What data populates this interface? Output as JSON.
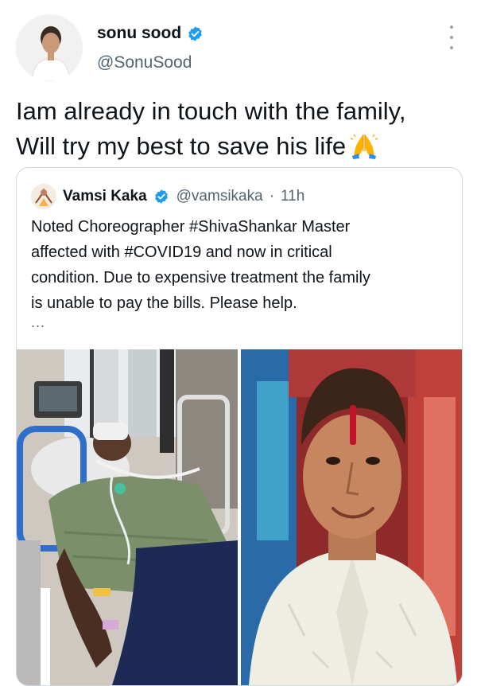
{
  "tweet": {
    "author": {
      "name": "sonu sood",
      "handle": "@SonuSood"
    },
    "text_lines": [
      "Iam already in touch with the family,",
      "Will try my best to save his life"
    ],
    "emoji": "folded-hands-icon"
  },
  "quoted_tweet": {
    "author": {
      "name": "Vamsi Kaka",
      "handle": "@vamsikaka",
      "separator": "·",
      "time": "11h"
    },
    "text_lines": [
      "Noted Choreographer #ShivaShankar Master",
      "affected with #COVID19 and now in critical",
      "condition. Due to expensive treatment the family",
      "is unable to pay the bills. Please help."
    ],
    "ellipsis": "..."
  },
  "colors": {
    "verified": "#1d9bf0",
    "muted": "#536471",
    "border": "#cfd9de"
  }
}
